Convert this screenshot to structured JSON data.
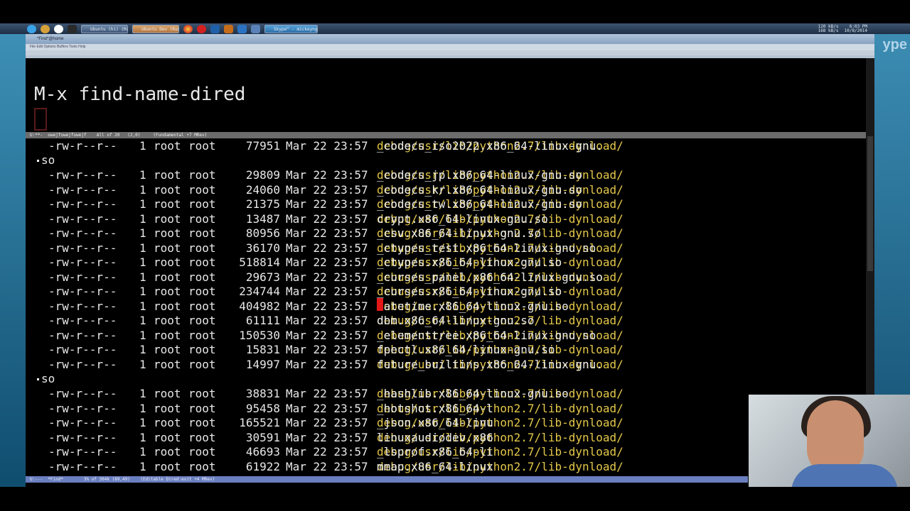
{
  "taskbar": {
    "tasks": [
      "Ubuntu (hi) (Ru...",
      "Ubuntu Dev (Run...",
      "Skype™ - mickeyng"
    ],
    "tray_net": "120 kB/s\n168 kB/s",
    "tray_time": "6:03 PM",
    "tray_date": "10/8/2014"
  },
  "emacs": {
    "window_title": "*Find*@home",
    "menu_items": "File   Edit   Options   Buffers   Tools   Help",
    "minibuffer_prompt": "M-x find-name-dired",
    "mode_line_top": "U:**-  owejfowejfowejf    All of 20   (2,0)     (Fundamental +7 MRev)",
    "mode_line_bottom": "U:---  *Find*        3% of 304k (89,49)    (Editable Dired:exit +4 MRev)"
  },
  "listing": {
    "first_row": {
      "perm": "-rw-r--r--",
      "links": "1",
      "owner": "root",
      "group": "root",
      "size": "77951",
      "date": "Mar 22 23:57",
      "path": "debug/usr/lib/python2.7/lib-dynload/",
      "name": "_codecs_iso2022.x86_64-linux-gnu."
    },
    "first_cont": "so",
    "rows": [
      {
        "perm": "-rw-r--r--",
        "links": "1",
        "owner": "root",
        "group": "root",
        "size": "29809",
        "date": "Mar 22 23:57",
        "path": "debug/usr/lib/python2.7/lib-dynload/",
        "name": "_codecs_jp.x86_64-linux-gnu.so"
      },
      {
        "perm": "-rw-r--r--",
        "links": "1",
        "owner": "root",
        "group": "root",
        "size": "24060",
        "date": "Mar 22 23:57",
        "path": "debug/usr/lib/python2.7/lib-dynload/",
        "name": "_codecs_kr.x86_64-linux-gnu.so"
      },
      {
        "perm": "-rw-r--r--",
        "links": "1",
        "owner": "root",
        "group": "root",
        "size": "21375",
        "date": "Mar 22 23:57",
        "path": "debug/usr/lib/python2.7/lib-dynload/",
        "name": "_codecs_tw.x86_64-linux-gnu.so"
      },
      {
        "perm": "-rw-r--r--",
        "links": "1",
        "owner": "root",
        "group": "root",
        "size": "13487",
        "date": "Mar 22 23:57",
        "path": "debug/usr/lib/python2.7/lib-dynload/",
        "name": "crypt.x86_64-linux-gnu.so"
      },
      {
        "perm": "-rw-r--r--",
        "links": "1",
        "owner": "root",
        "group": "root",
        "size": "80956",
        "date": "Mar 22 23:57",
        "path": "debug/usr/lib/python2.7/lib-dynload/",
        "name": "_csv.x86_64-linux-gnu.so"
      },
      {
        "perm": "-rw-r--r--",
        "links": "1",
        "owner": "root",
        "group": "root",
        "size": "36170",
        "date": "Mar 22 23:57",
        "path": "debug/usr/lib/python2.7/lib-dynload/",
        "name": "_ctypes_test.x86_64-linux-gnu.so"
      },
      {
        "perm": "-rw-r--r--",
        "links": "1",
        "owner": "root",
        "group": "root",
        "size": "518814",
        "date": "Mar 22 23:57",
        "path": "debug/usr/lib/python2.7/lib-dynload/",
        "name": "_ctypes.x86_64-linux-gnu.so"
      },
      {
        "perm": "-rw-r--r--",
        "links": "1",
        "owner": "root",
        "group": "root",
        "size": "29673",
        "date": "Mar 22 23:57",
        "path": "debug/usr/lib/python2.7/lib-dynload/",
        "name": "_curses_panel.x86_64-linux-gnu.so"
      },
      {
        "perm": "-rw-r--r--",
        "links": "1",
        "owner": "root",
        "group": "root",
        "size": "234744",
        "date": "Mar 22 23:57",
        "path": "debug/usr/lib/python2.7/lib-dynload/",
        "name": "_curses.x86_64-linux-gnu.so"
      },
      {
        "perm": "-rw-r--r--",
        "links": "1",
        "owner": "root",
        "group": "root",
        "size": "404982",
        "date": "Mar 22 23:57",
        "path": "debug/usr/lib/python2.7/lib-dynload/",
        "name": "datetime.x86_64-linux-gnu.so"
      },
      {
        "perm": "-rw-r--r--",
        "links": "1",
        "owner": "root",
        "group": "root",
        "size": "61111",
        "date": "Mar 22 23:57",
        "path": "debug/usr/lib/python2.7/lib-dynload/",
        "name": "dbm.x86_64-linux-gnu.so"
      },
      {
        "perm": "-rw-r--r--",
        "links": "1",
        "owner": "root",
        "group": "root",
        "size": "150530",
        "date": "Mar 22 23:57",
        "path": "debug/usr/lib/python2.7/lib-dynload/",
        "name": "_elementtree.x86_64-linux-gnu.so"
      },
      {
        "perm": "-rw-r--r--",
        "links": "1",
        "owner": "root",
        "group": "root",
        "size": "15831",
        "date": "Mar 22 23:57",
        "path": "debug/usr/lib/python2.7/lib-dynload/",
        "name": "fpectl.x86_64-linux-gnu.so"
      },
      {
        "perm": "-rw-r--r--",
        "links": "1",
        "owner": "root",
        "group": "root",
        "size": "14997",
        "date": "Mar 22 23:57",
        "path": "debug/usr/lib/python2.7/lib-dynload/",
        "name": "future_builtins.x86_64-linux-gnu."
      }
    ],
    "second_cont": "so",
    "rows2": [
      {
        "perm": "-rw-r--r--",
        "links": "1",
        "owner": "root",
        "group": "root",
        "size": "38831",
        "date": "Mar 22 23:57",
        "path": "debug/usr/lib/python2.7/lib-dynload/",
        "name": "_hashlib.x86_64-linux-gnu.so"
      },
      {
        "perm": "-rw-r--r--",
        "links": "1",
        "owner": "root",
        "group": "root",
        "size": "95458",
        "date": "Mar 22 23:57",
        "path": "debug/usr/lib/python2.7/lib-dynload/",
        "name": "_hotshot.x86_64-l"
      },
      {
        "perm": "-rw-r--r--",
        "links": "1",
        "owner": "root",
        "group": "root",
        "size": "165521",
        "date": "Mar 22 23:57",
        "path": "debug/usr/lib/python2.7/lib-dynload/",
        "name": "_json.x86_64-linu"
      },
      {
        "perm": "-rw-r--r--",
        "links": "1",
        "owner": "root",
        "group": "root",
        "size": "30591",
        "date": "Mar 22 23:57",
        "path": "debug/usr/lib/python2.7/lib-dynload/",
        "name": "linuxaudiodev.x86"
      },
      {
        "perm": "-rw-r--r--",
        "links": "1",
        "owner": "root",
        "group": "root",
        "size": "46693",
        "date": "Mar 22 23:57",
        "path": "debug/usr/lib/python2.7/lib-dynload/",
        "name": "_lsprof.x86_64-li"
      },
      {
        "perm": "-rw-r--r--",
        "links": "1",
        "owner": "root",
        "group": "root",
        "size": "61922",
        "date": "Mar 22 23:57",
        "path": "debug/usr/lib/python2.7/lib-dynload/",
        "name": "mmap.x86_64-linux"
      }
    ]
  },
  "colors": {
    "path": "#e4c84a",
    "cursor": "#e21818",
    "mode_line_bottom": "#6a7fbf"
  }
}
